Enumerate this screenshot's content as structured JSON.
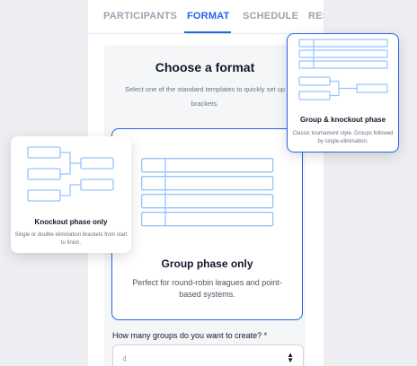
{
  "tabs": [
    {
      "label": "PARTICIPANTS",
      "active": false
    },
    {
      "label": "FORMAT",
      "active": true
    },
    {
      "label": "SCHEDULE",
      "active": false
    },
    {
      "label": "RES",
      "active": false
    }
  ],
  "format": {
    "heading": "Choose a format",
    "subtext": "Select one of the standard templates to quickly set up brackets."
  },
  "cards": {
    "group": {
      "title": "Group phase only",
      "description": "Perfect for round-robin leagues and point-based systems.",
      "icon": "group-table-icon"
    },
    "knockout": {
      "title": "Knockout phase only",
      "description": "Single or double elimination brackets from start to finish.",
      "icon": "knockout-bracket-icon"
    },
    "group_knockout": {
      "title": "Group & knockout phase",
      "description": "Classic tournament style. Groups followed by single-elimination.",
      "icon": "group-knockout-icon"
    }
  },
  "groups_field": {
    "label": "How many groups do you want to create? *",
    "value": "4"
  },
  "colors": {
    "accent": "#2563eb",
    "schematic": "#93c5fd"
  }
}
